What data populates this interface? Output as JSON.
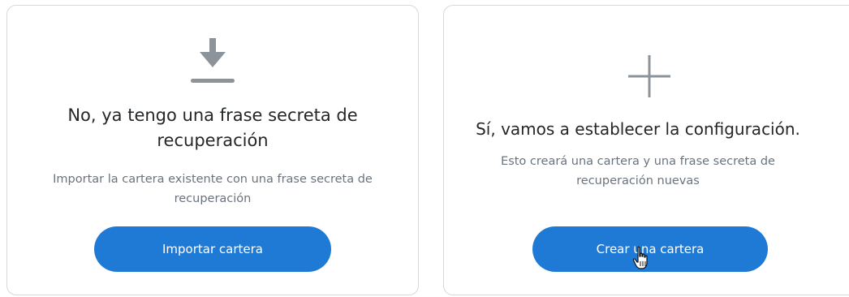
{
  "left_card": {
    "icon": "download-icon",
    "title_line1": "No, ya tengo una frase secreta de",
    "title_line2": "recuperación",
    "desc_line1": "Importar la cartera existente con una frase secreta de",
    "desc_line2": "recuperación",
    "button_label": "Importar cartera"
  },
  "right_card": {
    "icon": "plus-icon",
    "title": "Sí, vamos a establecer la configuración.",
    "desc_line1": "Esto creará una cartera y una frase secreta de",
    "desc_line2": "recuperación nuevas",
    "button_label": "Crear una cartera"
  },
  "colors": {
    "button": "#1f7ad6",
    "icon": "#8d939a",
    "title": "#24272a",
    "desc": "#6a737d",
    "border": "#d6d9dc"
  },
  "cursor": "hand-pointer-icon"
}
